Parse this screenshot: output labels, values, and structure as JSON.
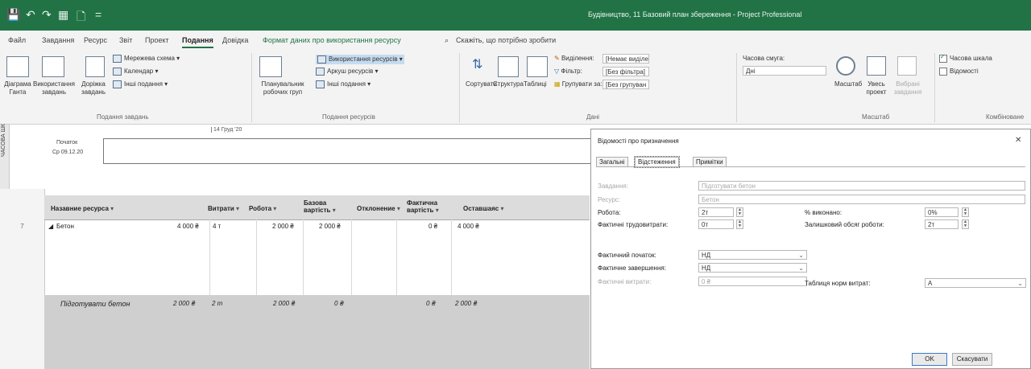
{
  "titlebar": {
    "title": "Будівництво, 11 Базовий план збереження - Project Professional",
    "quick_access": [
      "💾",
      "↶",
      "↷",
      "▦",
      "🗋",
      "="
    ]
  },
  "tabs": [
    {
      "label": "Файл",
      "state": "normal"
    },
    {
      "label": "Завдання",
      "state": "normal"
    },
    {
      "label": "Ресурс",
      "state": "normal"
    },
    {
      "label": "Звіт",
      "state": "normal"
    },
    {
      "label": "Проект",
      "state": "normal"
    },
    {
      "label": "Подання",
      "state": "active"
    },
    {
      "label": "Довідка",
      "state": "normal"
    },
    {
      "label": "Формат даних про використання ресурсу",
      "state": "contextual"
    },
    {
      "label": "Скажіть, що потрібно зробити",
      "state": "search"
    }
  ],
  "ribbon": {
    "gantt": "Діаграма Ганта",
    "task_usage": "Використання завдань",
    "other_views_task": "Доріжка завдань",
    "network": "Мережева схема",
    "calendar": "Календар",
    "other_views": "Інші подання",
    "group_task_views": "Подання завдань",
    "team_planner": "Планувальник робочих груп",
    "resource_usage": "Використання ресурсів",
    "resource_sheet": "Аркуш ресурсів",
    "other_views2": "Інші подання",
    "group_resource_views": "Подання ресурсів",
    "sort": "Сортувати",
    "outline": "Структура",
    "tables": "Таблиці",
    "highlight_label": "Виділення:",
    "highlight_value": "[Немає виділе",
    "filter_label": "Фільтр:",
    "filter_value": "[Без фільтра]",
    "group_label": "Групувати за:",
    "group_value": "[Без групуван",
    "group_data": "Дані",
    "timescale_label": "Часова смуга:",
    "timescale_value": "Дні",
    "zoom": "Масштаб",
    "entire_project": "Увесь проект",
    "selected_tasks": "Вибрані завдання",
    "group_zoom": "Масштаб",
    "timeline_chk": "Часова шкала",
    "details_chk": "Відомості",
    "group_split": "Комбіноване"
  },
  "timeline": {
    "side_label": "ЧАСОВА ШК",
    "start_label": "Початок",
    "start_date": "Ср 09.12.20",
    "date_marker": "14 Груд '20"
  },
  "table": {
    "headers": [
      {
        "label": "Назавние ресурса",
        "sub": ""
      },
      {
        "label": "Витрати",
        "sub": ""
      },
      {
        "label": "Робота",
        "sub": ""
      },
      {
        "label": "Базова",
        "sub": "вартість"
      },
      {
        "label": "Отклонение",
        "sub": ""
      },
      {
        "label": "Фактична",
        "sub": "вартість"
      },
      {
        "label": "Оставшаяс",
        "sub": ""
      }
    ],
    "resource_row": {
      "row_number": "7",
      "name": "Бетон",
      "cost": "4 000 ₴",
      "work": "4 т",
      "baseline": "2 000 ₴",
      "variance": "2 000 ₴",
      "actual": "0 ₴",
      "remaining": "4 000 ₴"
    },
    "assignment_row": {
      "name": "Підготувати бетон",
      "cost": "2 000 ₴",
      "work": "2 т",
      "baseline": "2 000 ₴",
      "variance": "0 ₴",
      "actual": "0 ₴",
      "remaining": "2 000 ₴"
    }
  },
  "dialog": {
    "title": "Відомості про призначення",
    "close": "✕",
    "tabs": [
      "Загальні",
      "Відстеження",
      "Примітки"
    ],
    "task_label": "Завдання:",
    "task_value": "Підготувати бетон",
    "resource_label": "Ресурс:",
    "resource_value": "Бетон",
    "work_label": "Робота:",
    "work_value": "2т",
    "pct_label": "% виконано:",
    "pct_value": "0%",
    "actual_work_label": "Фактичні трудовитрати:",
    "actual_work_value": "0т",
    "remaining_work_label": "Залишковий обсяг роботи:",
    "remaining_work_value": "2т",
    "actual_start_label": "Фактичний початок:",
    "actual_start_value": "НД",
    "actual_finish_label": "Фактичне завершення:",
    "actual_finish_value": "НД",
    "actual_cost_label": "Фактичні витрати:",
    "actual_cost_value": "0 ₴",
    "rate_table_label": "Таблиця норм витрат:",
    "rate_table_value": "A",
    "ok": "OK",
    "cancel": "Скасувати"
  },
  "colors": {
    "accent": "#217346",
    "ribbon_bg": "#f3f3f3"
  }
}
